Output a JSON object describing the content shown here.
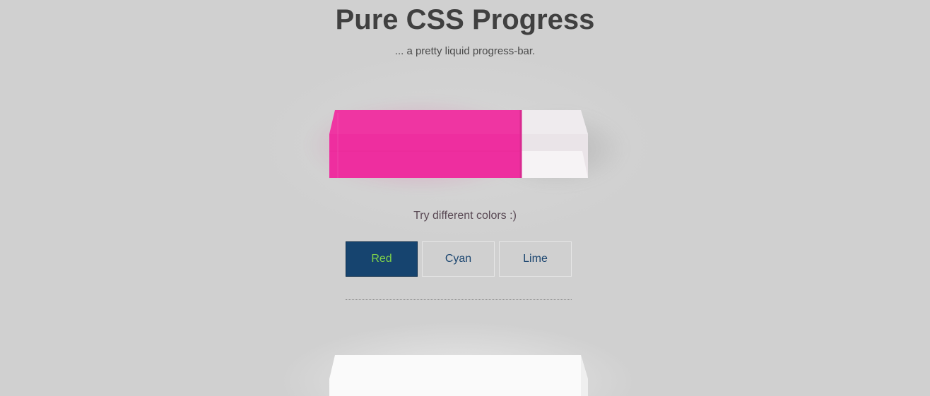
{
  "header": {
    "title": "Pure CSS Progress",
    "subtitle": "... a pretty liquid progress-bar."
  },
  "progress": {
    "fill_fraction": 0.74,
    "fill_color": "#ee2e9f",
    "glass_color": "#ece6ea"
  },
  "controls": {
    "prompt": "Try different colors :)",
    "options": [
      {
        "label": "Red",
        "active": true
      },
      {
        "label": "Cyan",
        "active": false
      },
      {
        "label": "Lime",
        "active": false
      }
    ]
  },
  "colors": {
    "background": "#d0d0d0",
    "active_button_bg": "#16446f",
    "active_button_text": "#7fd34a",
    "button_text": "#1c4670"
  }
}
